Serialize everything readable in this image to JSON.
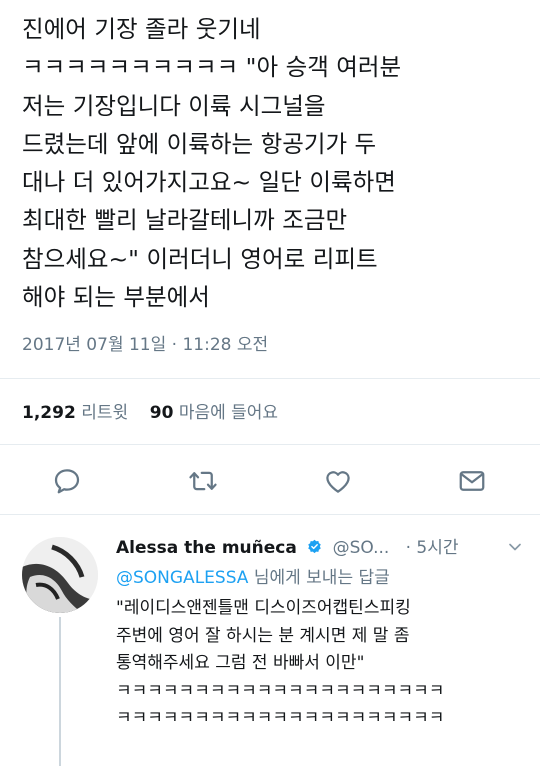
{
  "tweet": {
    "lines": [
      "진에어 기장 졸라 웃기네",
      "ㅋㅋㅋㅋㅋㅋㅋㅋㅋㅋ \"아 승객 여러분",
      "저는 기장입니다 이륙 시그널을",
      "드렸는데 앞에 이륙하는 항공기가 두",
      "대나 더 있어가지고요~ 일단 이륙하면",
      "최대한 빨리 날라갈테니까 조금만",
      "참으세요~\" 이러더니 영어로 리피트",
      "해야 되는 부분에서"
    ],
    "timestamp": "2017년 07월 11일 · 11:28 오전"
  },
  "stats": {
    "retweets_count": "1,292",
    "retweets_label": "리트윗",
    "likes_count": "90",
    "likes_label": "마음에 들어요"
  },
  "actions": {
    "icons": [
      "reply-icon",
      "retweet-icon",
      "like-icon",
      "share-icon"
    ]
  },
  "reply": {
    "name": "Alessa the muñeca",
    "handle": "@SO...",
    "dot": "·",
    "time": "5시간",
    "replying_to_mention": "@SONGALESSA",
    "replying_to_suffix": " 님에게 보내는 답글",
    "lines": [
      "\"레이디스앤젠틀맨 디스이즈어캡틴스피킹",
      "주변에 영어 잘 하시는 분 계시면 제 말 좀",
      "통역해주세요 그럼 전 바빠서 이만\"",
      "ㅋㅋㅋㅋㅋㅋㅋㅋㅋㅋㅋㅋㅋㅋㅋㅋㅋㅋㅋㅋㅋ",
      "ㅋㅋㅋㅋㅋㅋㅋㅋㅋㅋㅋㅋㅋㅋㅋㅋㅋㅋㅋㅋㅋ"
    ]
  },
  "colors": {
    "text": "#14171a",
    "secondary": "#657786",
    "link": "#1da1f2",
    "verified": "#1da1f2",
    "divider": "#e6ecf0"
  }
}
